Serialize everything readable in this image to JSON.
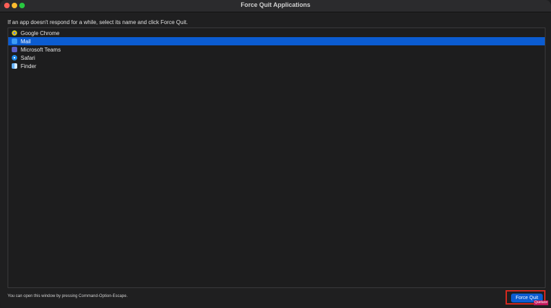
{
  "window": {
    "title": "Force Quit Applications"
  },
  "instruction": "If an app doesn't respond for a while, select its name and click Force Quit.",
  "apps": [
    {
      "name": "Google Chrome",
      "icon": "chrome-icon",
      "selected": false
    },
    {
      "name": "Mail",
      "icon": "mail-icon",
      "selected": true
    },
    {
      "name": "Microsoft Teams",
      "icon": "teams-icon",
      "selected": false
    },
    {
      "name": "Safari",
      "icon": "safari-icon",
      "selected": false
    },
    {
      "name": "Finder",
      "icon": "finder-icon",
      "selected": false
    }
  ],
  "footer": {
    "note": "You can open this window by pressing Command-Option-Escape.",
    "button_label": "Force Quit"
  },
  "watermark": "Quetuce",
  "colors": {
    "selection": "#0b5cd1",
    "highlight_box": "#d8291f"
  }
}
